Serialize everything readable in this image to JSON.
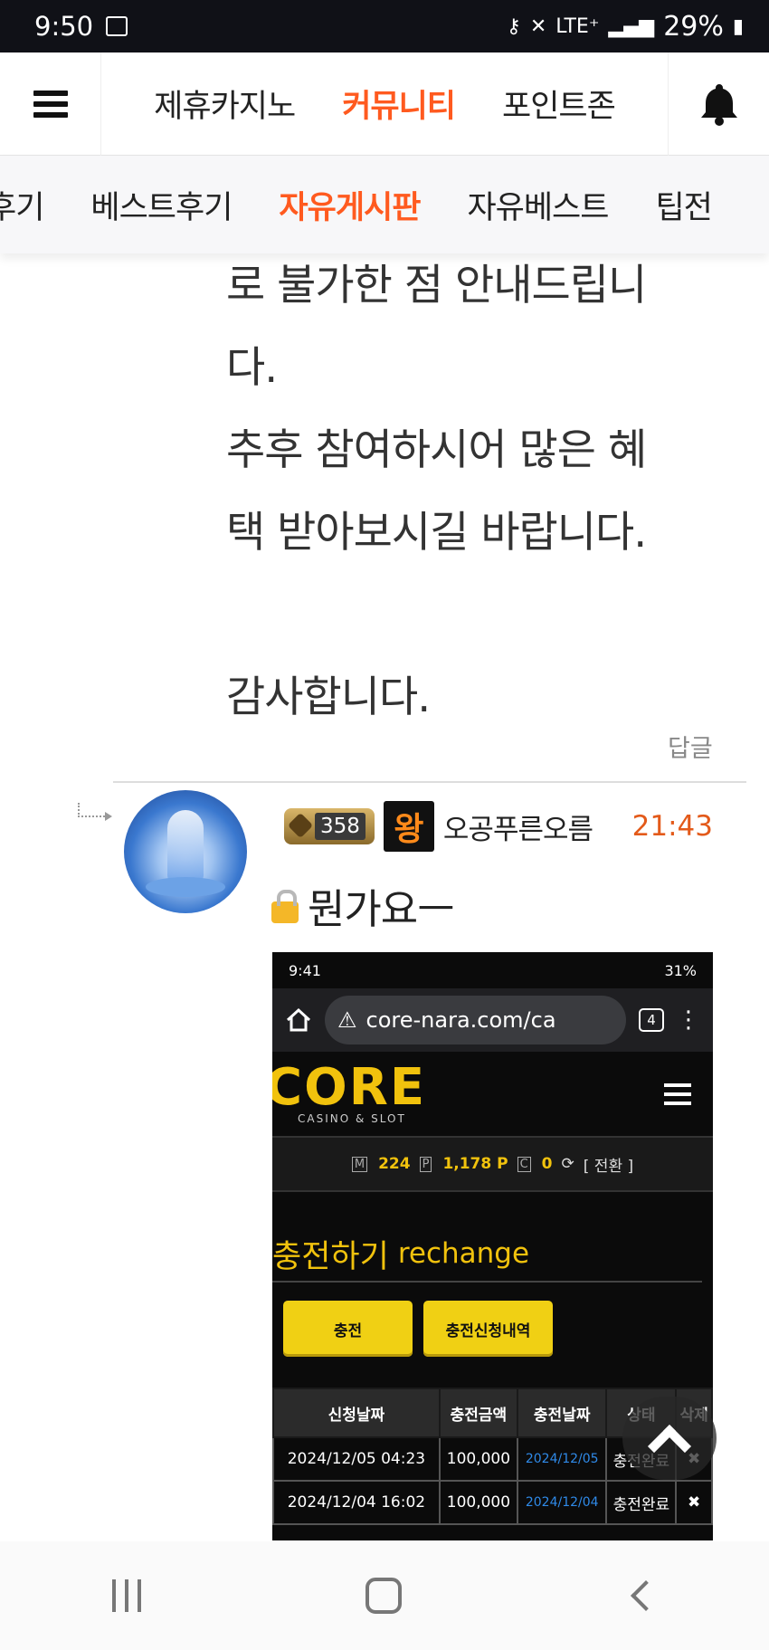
{
  "status": {
    "time": "9:50",
    "battery": "29%",
    "network": "LTE⁺"
  },
  "nav": {
    "items": [
      "제휴카지노",
      "커뮤니티",
      "포인트존"
    ],
    "active_index": 1
  },
  "subnav": {
    "items": [
      "후기",
      "베스트후기",
      "자유게시판",
      "자유베스트",
      "팁전"
    ],
    "active_index": 2
  },
  "post": {
    "lines": [
      "로 불가한 점 안내드립니",
      "다.",
      "추후 참여하시어 많은 혜",
      "택 받아보시길 바랍니다."
    ],
    "thanks": "감사합니다.",
    "reply_label": "답글"
  },
  "comment": {
    "level": "358",
    "badge": "왕",
    "username": "오공푸른오름",
    "time": "21:43",
    "text": "뭔가요ㅡ"
  },
  "embedded_screenshot": {
    "status_time": "9:41",
    "battery": "31%",
    "url": "core-nara.com/ca",
    "tab_count": "4",
    "logo": "CORE",
    "logo_sub": "CASINO & SLOT",
    "points": {
      "m": "224",
      "p": "1,178 P",
      "c": "0",
      "switch_label": "[ 전환 ]"
    },
    "title_ko": "충전하기",
    "title_en": "rechange",
    "buttons": [
      "충전",
      "충전신청내역"
    ],
    "table": {
      "headers": [
        "신청날짜",
        "충전금액",
        "충전날짜",
        "상태",
        "삭제"
      ],
      "rows": [
        [
          "2024/12/05 04:23",
          "100,000",
          "2024/12/05",
          "충전완료",
          "✖"
        ],
        [
          "2024/12/04 16:02",
          "100,000",
          "2024/12/04",
          "충전완료",
          "✖"
        ]
      ]
    }
  },
  "colors": {
    "accent": "#ff5a1f",
    "time": "#e35a1a",
    "embed_gold": "#f1c20d"
  }
}
